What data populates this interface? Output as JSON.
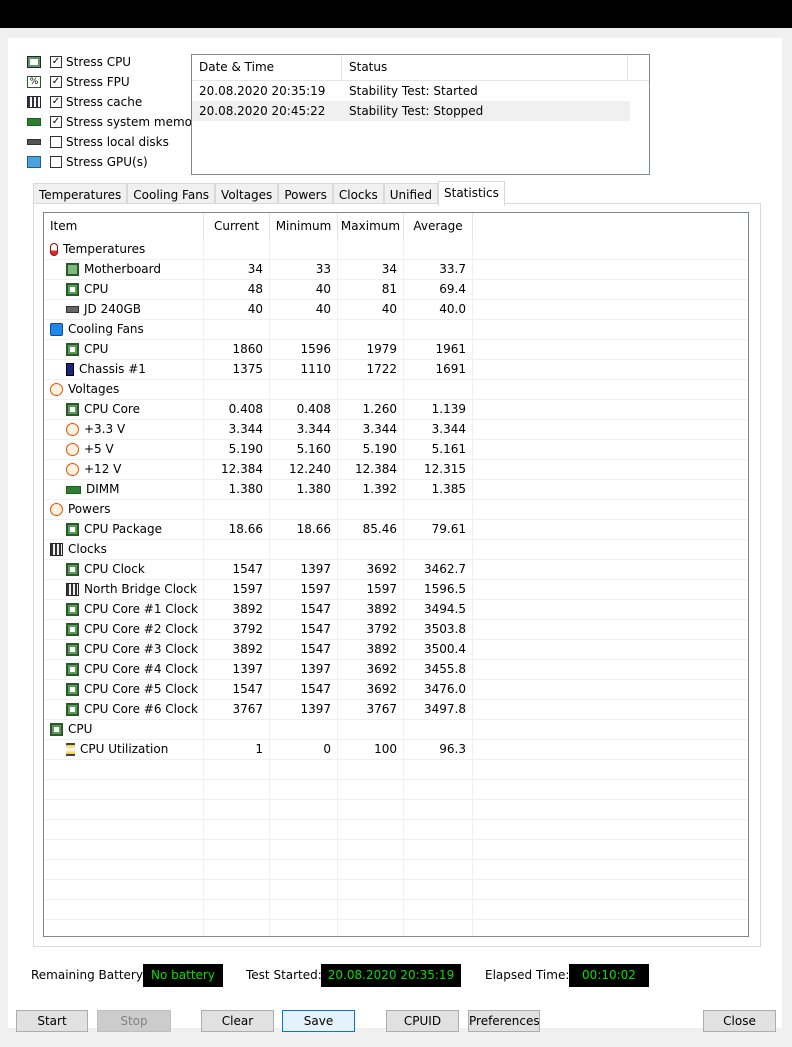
{
  "stress_options": [
    {
      "label": "Stress CPU",
      "checked": true,
      "icon": "cpu-chip-icon"
    },
    {
      "label": "Stress FPU",
      "checked": true,
      "icon": "percent-icon"
    },
    {
      "label": "Stress cache",
      "checked": true,
      "icon": "cache-chip-icon"
    },
    {
      "label": "Stress system memory",
      "checked": true,
      "icon": "memory-module-icon"
    },
    {
      "label": "Stress local disks",
      "checked": false,
      "icon": "disk-drive-icon"
    },
    {
      "label": "Stress GPU(s)",
      "checked": false,
      "icon": "monitor-icon"
    }
  ],
  "check_mark": "✓",
  "log": {
    "headers": [
      "Date & Time",
      "Status"
    ],
    "rows": [
      {
        "time": "20.08.2020 20:35:19",
        "status": "Stability Test: Started"
      },
      {
        "time": "20.08.2020 20:45:22",
        "status": "Stability Test: Stopped"
      }
    ]
  },
  "tabs": [
    "Temperatures",
    "Cooling Fans",
    "Voltages",
    "Powers",
    "Clocks",
    "Unified",
    "Statistics"
  ],
  "active_tab": "Statistics",
  "stats": {
    "headers": [
      "Item",
      "Current",
      "Minimum",
      "Maximum",
      "Average"
    ],
    "rows": [
      {
        "kind": "cat",
        "icon": "thermometer-icon",
        "item": "Temperatures"
      },
      {
        "kind": "leaf",
        "icon": "motherboard-icon",
        "item": "Motherboard",
        "current": "34",
        "min": "33",
        "max": "34",
        "avg": "33.7"
      },
      {
        "kind": "leaf",
        "icon": "cpu-chip-icon",
        "item": "CPU",
        "current": "48",
        "min": "40",
        "max": "81",
        "avg": "69.4"
      },
      {
        "kind": "leaf",
        "icon": "disk-drive-icon",
        "item": "JD 240GB",
        "current": "40",
        "min": "40",
        "max": "40",
        "avg": "40.0"
      },
      {
        "kind": "cat",
        "icon": "fan-icon",
        "item": "Cooling Fans"
      },
      {
        "kind": "leaf",
        "icon": "cpu-chip-icon",
        "item": "CPU",
        "current": "1860",
        "min": "1596",
        "max": "1979",
        "avg": "1961"
      },
      {
        "kind": "leaf",
        "icon": "chassis-icon",
        "item": "Chassis #1",
        "current": "1375",
        "min": "1110",
        "max": "1722",
        "avg": "1691"
      },
      {
        "kind": "cat",
        "icon": "voltage-icon",
        "item": "Voltages"
      },
      {
        "kind": "leaf",
        "icon": "cpu-chip-icon",
        "item": "CPU Core",
        "current": "0.408",
        "min": "0.408",
        "max": "1.260",
        "avg": "1.139"
      },
      {
        "kind": "leaf",
        "icon": "voltage-icon",
        "item": "+3.3 V",
        "current": "3.344",
        "min": "3.344",
        "max": "3.344",
        "avg": "3.344"
      },
      {
        "kind": "leaf",
        "icon": "voltage-icon",
        "item": "+5 V",
        "current": "5.190",
        "min": "5.160",
        "max": "5.190",
        "avg": "5.161"
      },
      {
        "kind": "leaf",
        "icon": "voltage-icon",
        "item": "+12 V",
        "current": "12.384",
        "min": "12.240",
        "max": "12.384",
        "avg": "12.315"
      },
      {
        "kind": "leaf",
        "icon": "memory-module-icon",
        "item": "DIMM",
        "current": "1.380",
        "min": "1.380",
        "max": "1.392",
        "avg": "1.385"
      },
      {
        "kind": "cat",
        "icon": "voltage-icon",
        "item": "Powers"
      },
      {
        "kind": "leaf",
        "icon": "cpu-chip-icon",
        "item": "CPU Package",
        "current": "18.66",
        "min": "18.66",
        "max": "85.46",
        "avg": "79.61"
      },
      {
        "kind": "cat",
        "icon": "clock-chip-icon",
        "item": "Clocks"
      },
      {
        "kind": "leaf",
        "icon": "cpu-chip-icon",
        "item": "CPU Clock",
        "current": "1547",
        "min": "1397",
        "max": "3692",
        "avg": "3462.7"
      },
      {
        "kind": "leaf",
        "icon": "clock-chip-icon",
        "item": "North Bridge Clock",
        "current": "1597",
        "min": "1597",
        "max": "1597",
        "avg": "1596.5"
      },
      {
        "kind": "leaf",
        "icon": "cpu-chip-icon",
        "item": "CPU Core #1 Clock",
        "current": "3892",
        "min": "1547",
        "max": "3892",
        "avg": "3494.5"
      },
      {
        "kind": "leaf",
        "icon": "cpu-chip-icon",
        "item": "CPU Core #2 Clock",
        "current": "3792",
        "min": "1547",
        "max": "3792",
        "avg": "3503.8"
      },
      {
        "kind": "leaf",
        "icon": "cpu-chip-icon",
        "item": "CPU Core #3 Clock",
        "current": "3892",
        "min": "1547",
        "max": "3892",
        "avg": "3500.4"
      },
      {
        "kind": "leaf",
        "icon": "cpu-chip-icon",
        "item": "CPU Core #4 Clock",
        "current": "1397",
        "min": "1397",
        "max": "3692",
        "avg": "3455.8"
      },
      {
        "kind": "leaf",
        "icon": "cpu-chip-icon",
        "item": "CPU Core #5 Clock",
        "current": "1547",
        "min": "1547",
        "max": "3692",
        "avg": "3476.0"
      },
      {
        "kind": "leaf",
        "icon": "cpu-chip-icon",
        "item": "CPU Core #6 Clock",
        "current": "3767",
        "min": "1397",
        "max": "3767",
        "avg": "3497.8"
      },
      {
        "kind": "cat",
        "icon": "cpu-chip-icon",
        "item": "CPU"
      },
      {
        "kind": "leaf",
        "icon": "hourglass-icon",
        "item": "CPU Utilization",
        "current": "1",
        "min": "0",
        "max": "100",
        "avg": "96.3"
      }
    ]
  },
  "status_bar": {
    "battery_label": "Remaining Battery:",
    "battery_value": "No battery",
    "started_label": "Test Started:",
    "started_value": "20.08.2020 20:35:19",
    "elapsed_label": "Elapsed Time:",
    "elapsed_value": "00:10:02"
  },
  "buttons": {
    "start": "Start",
    "stop": "Stop",
    "clear": "Clear",
    "save": "Save",
    "cpuid": "CPUID",
    "preferences": "Preferences",
    "close": "Close"
  },
  "colors": {
    "lcd_text": "#00e000",
    "lcd_bg": "#000000",
    "focus_border": "#0078d7"
  }
}
